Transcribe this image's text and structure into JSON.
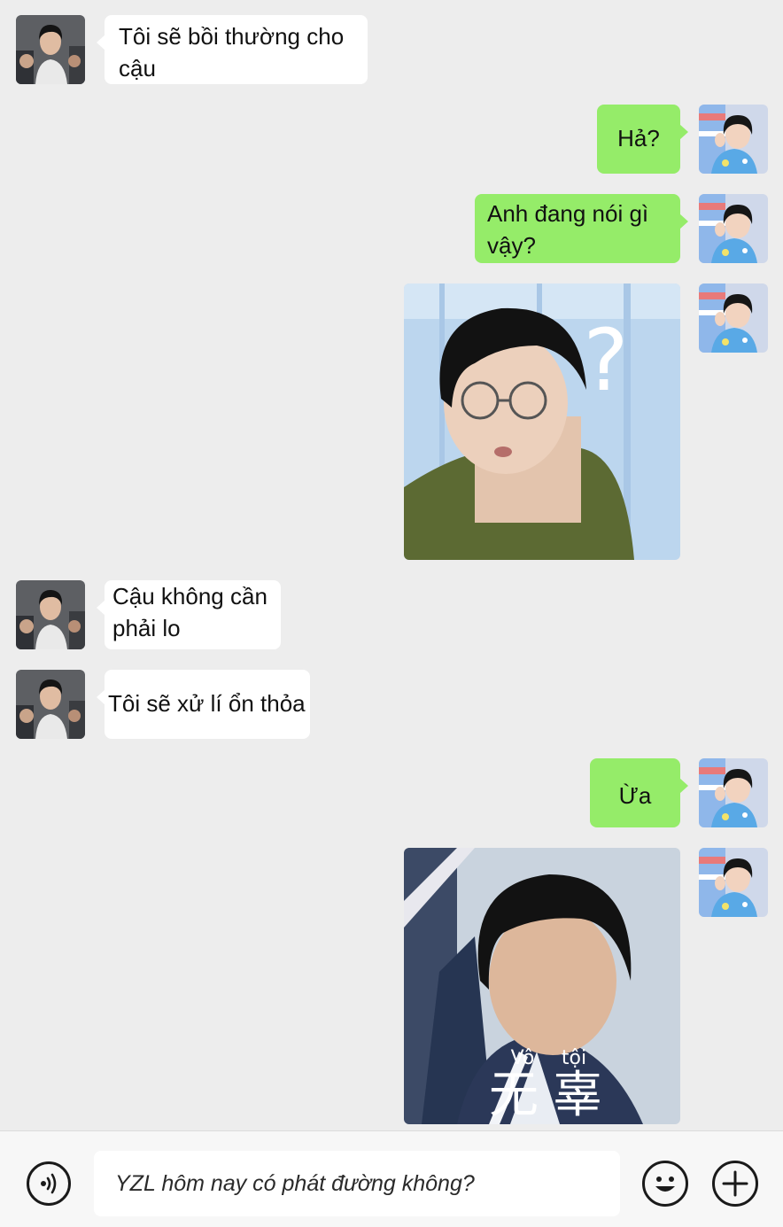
{
  "messages": [
    {
      "side": "left",
      "type": "text",
      "text": "Tôi sẽ bồi thường cho cậu"
    },
    {
      "side": "right",
      "type": "text",
      "text": "Hả?"
    },
    {
      "side": "right",
      "type": "text",
      "text": "Anh đang nói gì vậy?"
    },
    {
      "side": "right",
      "type": "sticker",
      "overlay": "?"
    },
    {
      "side": "left",
      "type": "text",
      "text": "Cậu không cần phải lo"
    },
    {
      "side": "left",
      "type": "text",
      "text": "Tôi sẽ xử lí ổn thỏa"
    },
    {
      "side": "right",
      "type": "text",
      "text": "Ừa"
    },
    {
      "side": "right",
      "type": "sticker",
      "subtitle_small": [
        "Vô",
        "tội"
      ],
      "subtitle_big": [
        "无",
        "辜"
      ]
    }
  ],
  "input": {
    "value": "YZL hôm nay có phát đường không?"
  },
  "icons": {
    "voice": "voice-icon",
    "emoji": "emoji-icon",
    "add": "plus-icon"
  },
  "colors": {
    "background": "#ededed",
    "incoming_bubble": "#ffffff",
    "outgoing_bubble": "#95ec69"
  }
}
